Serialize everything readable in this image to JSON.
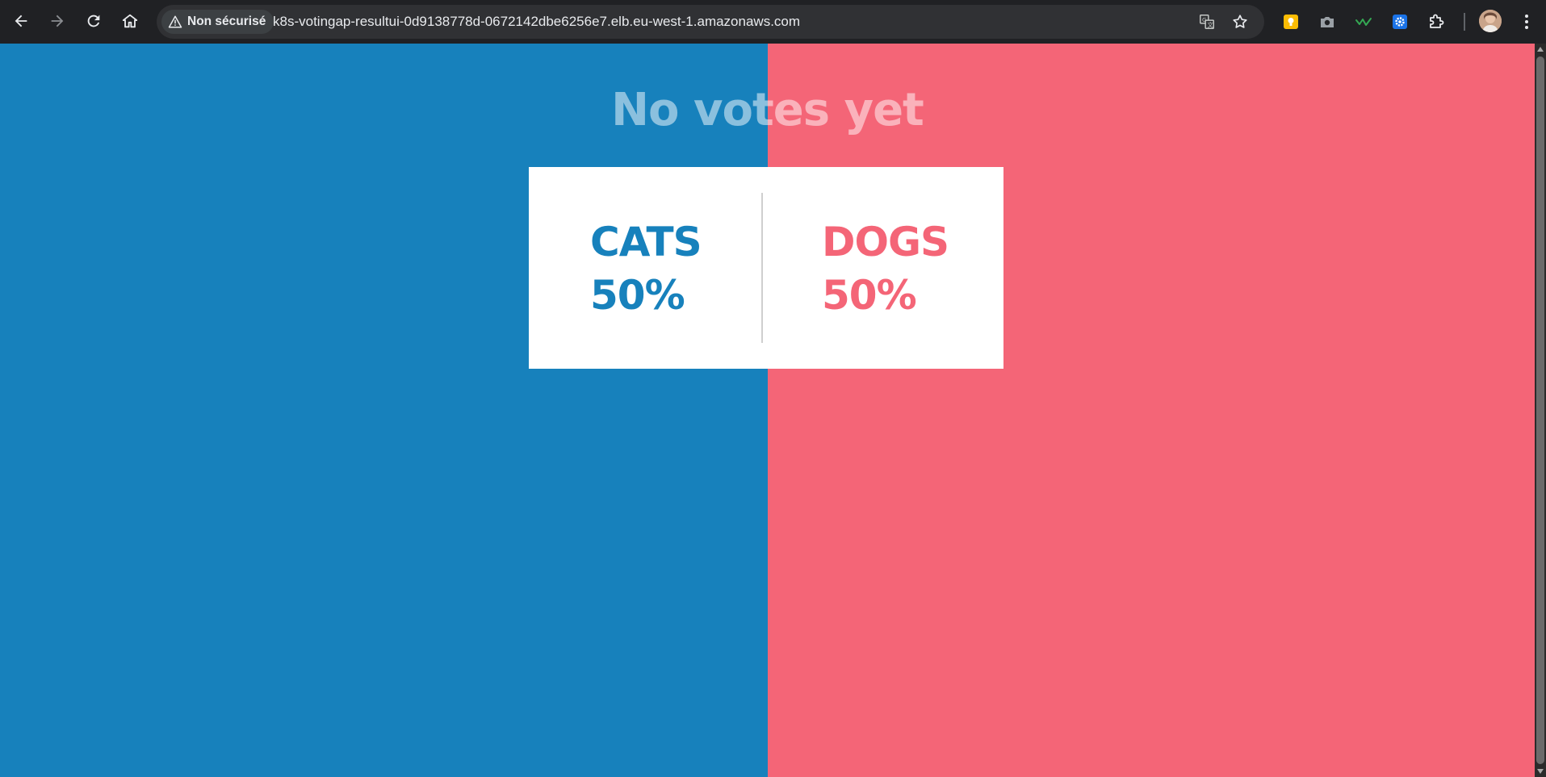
{
  "browser": {
    "security_label": "Non sécurisé",
    "url": "k8s-votingap-resultui-0d9138778d-0672142dbe6256e7.elb.eu-west-1.amazonaws.com",
    "nav_icons": [
      "back-arrow-icon",
      "forward-arrow-icon",
      "reload-icon",
      "home-icon"
    ],
    "omnibox_icons": [
      "warning-triangle-icon",
      "translate-icon",
      "star-icon"
    ],
    "extension_icons": [
      "keep-lightbulb-extension-icon",
      "camera-extension-icon",
      "checkmark-wave-extension-icon",
      "gear-extension-icon",
      "puzzle-extensions-icon",
      "kebab-menu-icon"
    ]
  },
  "page": {
    "headline": "No votes yet",
    "option_a": {
      "label": "CATS",
      "percent": "50%",
      "color": "#1781bc"
    },
    "option_b": {
      "label": "DOGS",
      "percent": "50%",
      "color": "#f46577"
    },
    "split_ratio": 0.5
  }
}
